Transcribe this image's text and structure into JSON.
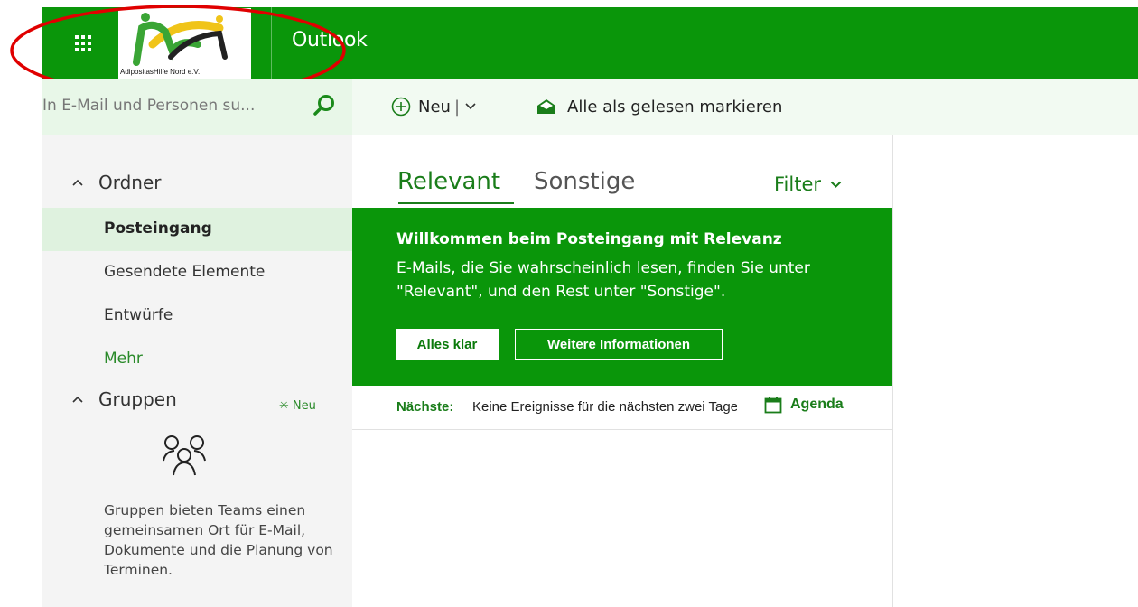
{
  "header": {
    "app_title": "Outlook",
    "logo_text": "AdipositasHilfe Nord e.V."
  },
  "search": {
    "placeholder": "In E-Mail und Personen su..."
  },
  "toolbar": {
    "new_label": "Neu",
    "mark_all_read_label": "Alle als gelesen markieren"
  },
  "sidebar": {
    "folders_heading": "Ordner",
    "items": [
      {
        "label": "Posteingang",
        "active": true
      },
      {
        "label": "Gesendete Elemente",
        "active": false
      },
      {
        "label": "Entwürfe",
        "active": false
      }
    ],
    "more_label": "Mehr",
    "groups_heading": "Gruppen",
    "groups_new_label": "Neu",
    "groups_description": "Gruppen bieten Teams einen gemeinsamen Ort für E-Mail, Dokumente und die Planung von Terminen."
  },
  "inbox": {
    "tab_focused": "Relevant",
    "tab_other": "Sonstige",
    "filter_label": "Filter",
    "banner": {
      "title": "Willkommen beim Posteingang mit Relevanz",
      "body": "E-Mails, die Sie wahrscheinlich lesen, finden Sie unter \"Relevant\", und den Rest unter \"Sonstige\".",
      "ok_button": "Alles klar",
      "info_button": "Weitere Informationen"
    },
    "agenda": {
      "next_label": "Nächste:",
      "next_text": "Keine Ereignisse für die nächsten zwei Tage",
      "agenda_link": "Agenda"
    }
  },
  "colors": {
    "brand_green": "#0a960a",
    "accent_text_green": "#1a7d1a",
    "highlight_red": "#e00000"
  }
}
